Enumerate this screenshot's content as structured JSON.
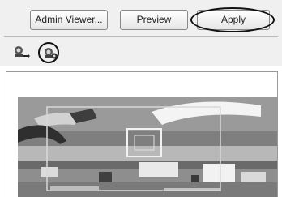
{
  "toolbar": {
    "admin_viewer_label": "Admin Viewer...",
    "preview_label": "Preview",
    "apply_label": "Apply"
  },
  "icons": {
    "tool_1": "camera-arrow-icon",
    "tool_2": "camera-settings-icon"
  },
  "colors": {
    "panel_bg": "#f0f0f0",
    "highlight_ring": "#111111",
    "frame_border": "#999999"
  }
}
